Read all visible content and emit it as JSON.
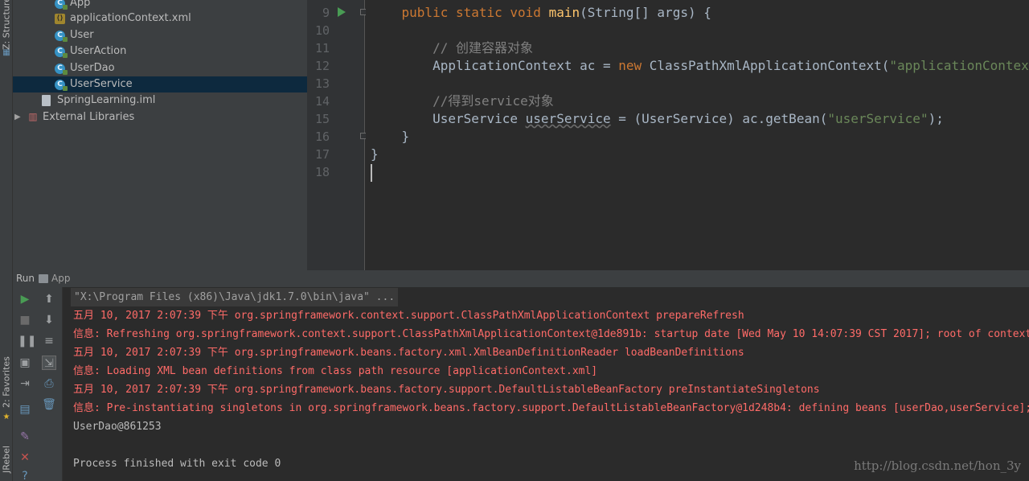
{
  "sidebar_tabs": {
    "structure": "Z: Structure",
    "favorites": "2: Favorites",
    "jrebel": "JRebel"
  },
  "project_tree": [
    {
      "label": "App",
      "icon": "class-icon",
      "lock": true
    },
    {
      "label": "applicationContext.xml",
      "icon": "xml-icon",
      "lock": false
    },
    {
      "label": "User",
      "icon": "class-icon",
      "lock": true
    },
    {
      "label": "UserAction",
      "icon": "class-icon",
      "lock": true
    },
    {
      "label": "UserDao",
      "icon": "class-icon",
      "lock": true
    },
    {
      "label": "UserService",
      "icon": "class-icon",
      "lock": true,
      "selected": true
    },
    {
      "label": "SpringLearning.iml",
      "icon": "iml-icon",
      "lock": false
    },
    {
      "label": "External Libraries",
      "icon": "library-icon",
      "lock": false,
      "collapsed": true
    }
  ],
  "editor": {
    "line_numbers": [
      "9",
      "10",
      "11",
      "12",
      "13",
      "14",
      "15",
      "16",
      "17",
      "18"
    ],
    "lines": {
      "l9": {
        "kw1": "public static void ",
        "fn": "main",
        "rest": "(String[] args) {"
      },
      "l11": {
        "comment": "// 创建容器对象"
      },
      "l12": {
        "a": "ApplicationContext ac = ",
        "kw": "new",
        "b": " ClassPathXmlApplicationContext(",
        "str": "\"applicationContext.xml\"",
        "c": ");"
      },
      "l14": {
        "comment": "//得到service对象"
      },
      "l15": {
        "a": "UserService ",
        "var": "userService",
        "b": " = (UserService) ac.getBean(",
        "str": "\"userService\"",
        "c": ");"
      },
      "l16": "}",
      "l17": "}"
    }
  },
  "run_panel": {
    "tab_label": "Run",
    "config_name": "App",
    "console": [
      {
        "type": "cmd",
        "text": "\"X:\\Program Files (x86)\\Java\\jdk1.7.0\\bin\\java\" ..."
      },
      {
        "type": "red",
        "text": "五月 10, 2017 2:07:39 下午 org.springframework.context.support.ClassPathXmlApplicationContext prepareRefresh"
      },
      {
        "type": "red",
        "text": "信息: Refreshing org.springframework.context.support.ClassPathXmlApplicationContext@1de891b: startup date [Wed May 10 14:07:39 CST 2017]; root of context hierarchy"
      },
      {
        "type": "red",
        "text": "五月 10, 2017 2:07:39 下午 org.springframework.beans.factory.xml.XmlBeanDefinitionReader loadBeanDefinitions"
      },
      {
        "type": "red",
        "text": "信息: Loading XML bean definitions from class path resource [applicationContext.xml]"
      },
      {
        "type": "red",
        "text": "五月 10, 2017 2:07:39 下午 org.springframework.beans.factory.support.DefaultListableBeanFactory preInstantiateSingletons"
      },
      {
        "type": "red",
        "text": "信息: Pre-instantiating singletons in org.springframework.beans.factory.support.DefaultListableBeanFactory@1d248b4: defining beans [userDao,userService]; root of factory hierarchy"
      },
      {
        "type": "norm",
        "text": "UserDao@861253"
      },
      {
        "type": "norm",
        "text": ""
      },
      {
        "type": "norm",
        "text": "Process finished with exit code 0"
      }
    ]
  },
  "watermark": "http://blog.csdn.net/hon_3y"
}
